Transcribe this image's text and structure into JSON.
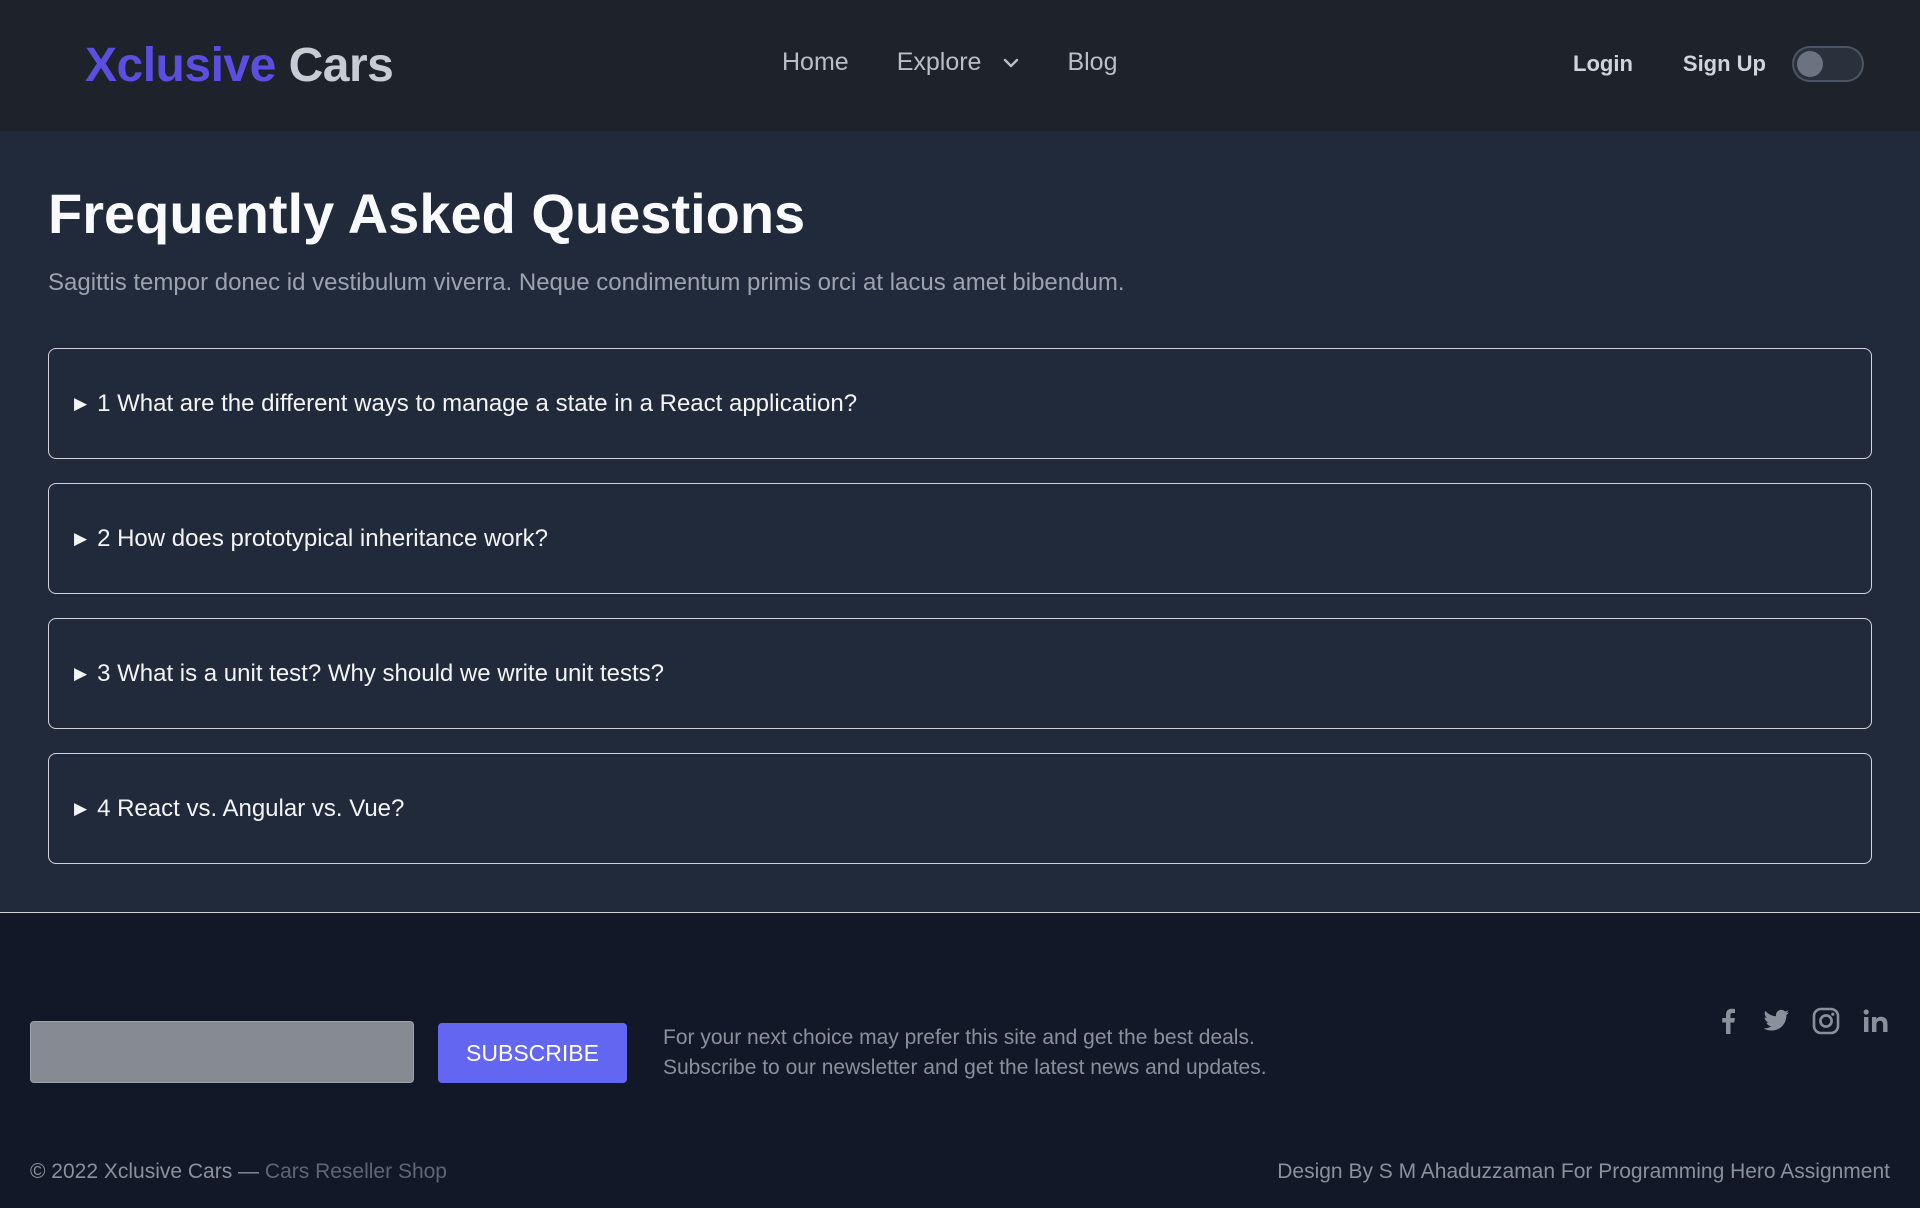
{
  "header": {
    "logo_brand": "Xclusive",
    "logo_rest": "Cars",
    "nav": {
      "home": "Home",
      "explore": "Explore",
      "blog": "Blog"
    },
    "login": "Login",
    "signup": "Sign Up"
  },
  "main": {
    "title": "Frequently Asked Questions",
    "subtitle": "Sagittis tempor donec id vestibulum viverra. Neque condimentum primis orci at lacus amet bibendum.",
    "faq_arrow": "▶",
    "faqs": [
      {
        "question": "1 What are the different ways to manage a state in a React application?"
      },
      {
        "question": "2 How does prototypical inheritance work?"
      },
      {
        "question": "3 What is a unit test? Why should we write unit tests?"
      },
      {
        "question": "4 React vs. Angular vs. Vue?"
      }
    ]
  },
  "footer": {
    "email_value": "",
    "subscribe": "SUBSCRIBE",
    "text_line1": "For your next choice may prefer this site and get the best deals.",
    "text_line2": "Subscribe to our newsletter and get the latest news and updates.",
    "socials": [
      "facebook-icon",
      "twitter-icon",
      "instagram-icon",
      "linkedin-icon"
    ],
    "copyright": "© 2022 Xclusive Cars — ",
    "copyright_shop": "Cars Reseller Shop",
    "credit": "Design By S M Ahaduzzaman For Programming Hero Assignment"
  },
  "colors": {
    "brand": "#5b4ee0",
    "accent": "#6366f1",
    "header_bg": "#1d222b",
    "main_bg": "#212a3a",
    "footer_bg": "#111827"
  }
}
